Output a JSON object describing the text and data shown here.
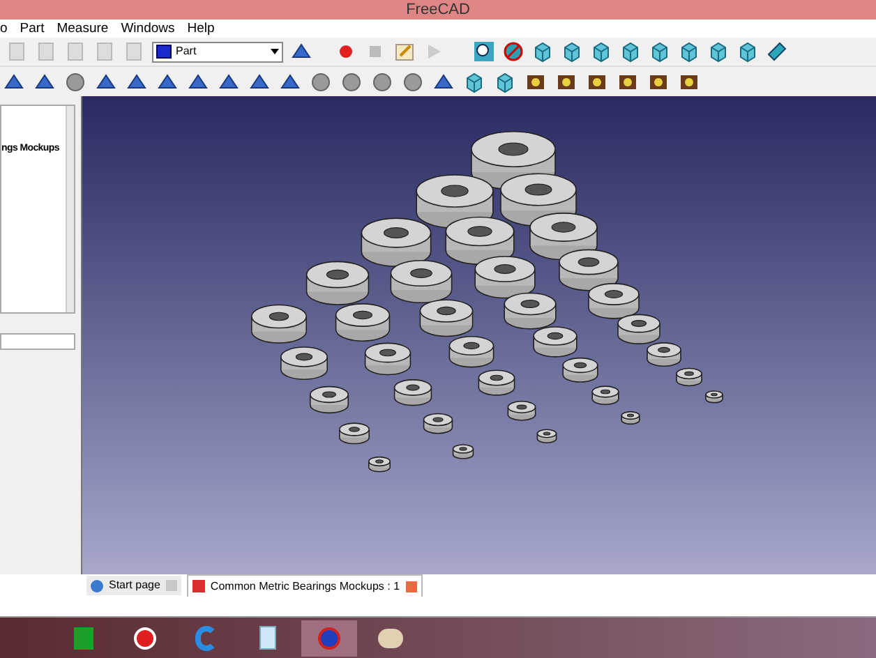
{
  "window": {
    "title": "FreeCAD"
  },
  "menu": [
    {
      "label": "o"
    },
    {
      "label": "Part"
    },
    {
      "label": "Measure"
    },
    {
      "label": "Windows"
    },
    {
      "label": "Help"
    }
  ],
  "workbench": {
    "value": "Part"
  },
  "tree_panel": {
    "item": "ngs Mockups"
  },
  "tabs": [
    {
      "label": "Start page",
      "selected": false
    },
    {
      "label": "Common Metric Bearings Mockups : 1",
      "selected": true
    }
  ]
}
